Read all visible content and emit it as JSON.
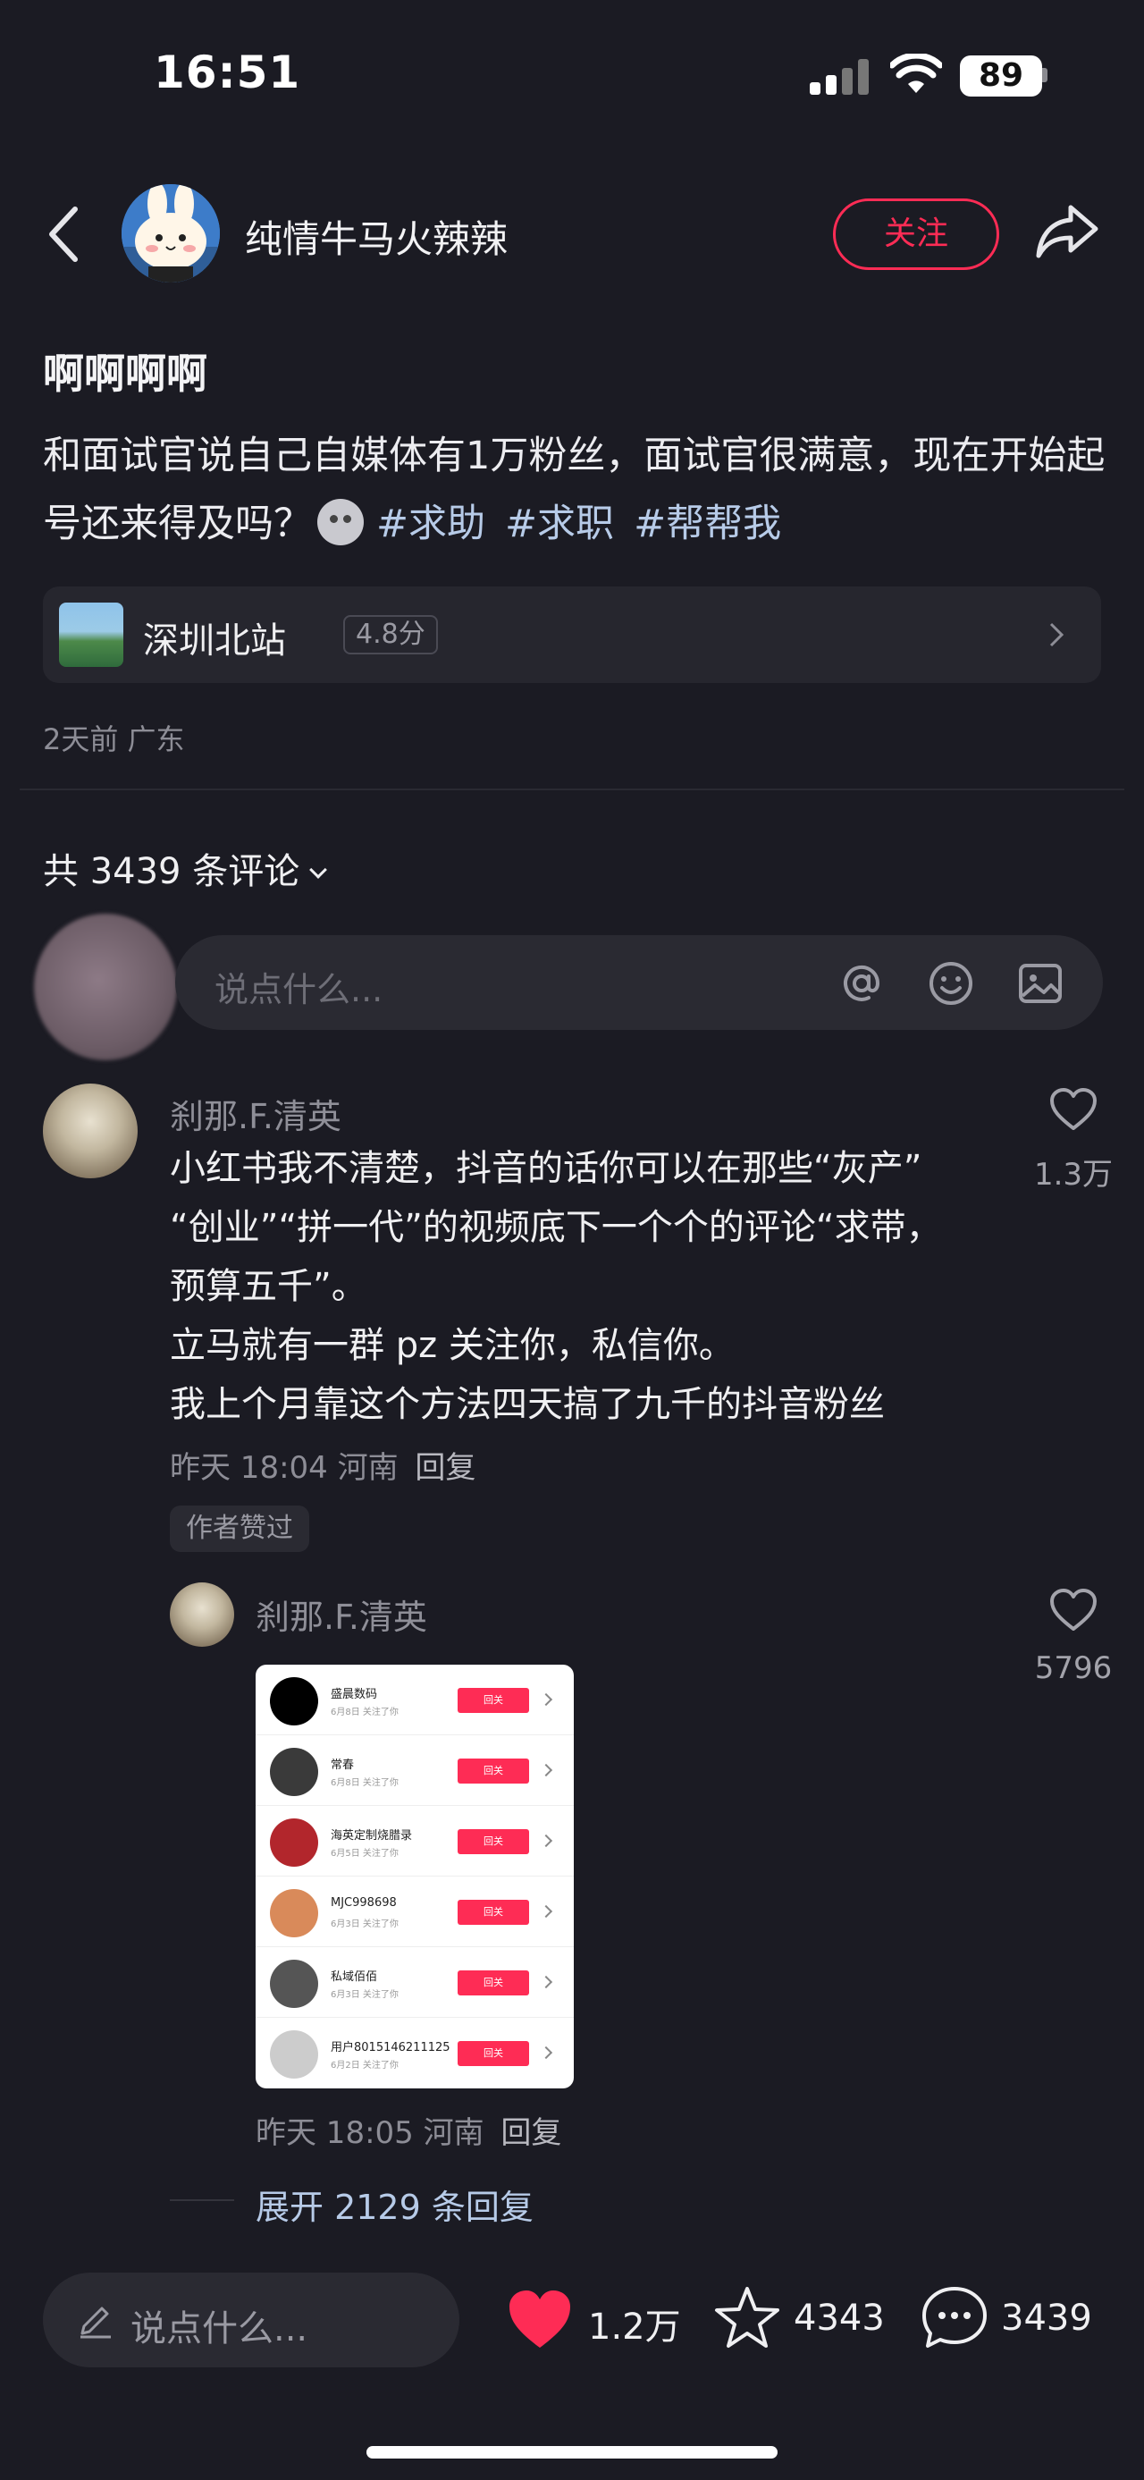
{
  "status_bar": {
    "time": "16:51",
    "battery": "89"
  },
  "header": {
    "author_name": "纯情牛马火辣辣",
    "follow_label": "关注",
    "icons": [
      "back-icon",
      "share-icon"
    ]
  },
  "post": {
    "title": "啊啊啊啊",
    "body": "和面试官说自己自媒体有1万粉丝，面试官很满意，现在开始起号还来得及吗？",
    "tags": [
      "#求助",
      "#求职",
      "#帮帮我"
    ],
    "location": {
      "name": "深圳北站",
      "rating": "4.8分"
    },
    "meta": "2天前 广东"
  },
  "comments_section": {
    "count_label": "共 3439 条评论",
    "compose_placeholder": "说点什么...",
    "compose_icons": [
      "at-icon",
      "emoji-icon",
      "image-icon"
    ],
    "comments": [
      {
        "user": "刹那.F.清英",
        "lines": [
          "小红书我不清楚，抖音的话你可以在那些“灰产”",
          "“创业”“拼一代”的视频底下一个个的评论“求带，",
          "预算五千”。",
          "立马就有一群 pz 关注你，私信你。",
          "我上个月靠这个方法四天搞了九千的抖音粉丝"
        ],
        "time": "昨天 18:04 河南",
        "reply_label": "回复",
        "like_count": "1.3万",
        "badge": "作者赞过"
      },
      {
        "user": "刹那.F.清英",
        "time": "昨天 18:05 河南",
        "reply_label": "回复",
        "like_count": "5796",
        "screenshot_rows": [
          {
            "name": "盛晨数码",
            "date": "6月8日 关注了你",
            "button": "回关",
            "avatar_color": "#000000"
          },
          {
            "name": "常春",
            "date": "6月8日 关注了你",
            "button": "回关",
            "avatar_color": "#3a3a3a"
          },
          {
            "name": "海英定制烧腊录",
            "date": "6月5日 关注了你",
            "button": "回关",
            "avatar_color": "#b2262c"
          },
          {
            "name": "MJC998698",
            "date": "6月3日 关注了你",
            "button": "回关",
            "avatar_color": "#d98a5a"
          },
          {
            "name": "私域佰佰",
            "date": "6月3日 关注了你",
            "button": "回关",
            "avatar_color": "#555555"
          },
          {
            "name": "用户8015146211125",
            "date": "6月2日 关注了你",
            "button": "回关",
            "avatar_color": "#cccccc"
          }
        ]
      }
    ],
    "expand_label": "展开 2129 条回复"
  },
  "bottom_bar": {
    "input_placeholder": "说点什么...",
    "like_count": "1.2万",
    "star_count": "4343",
    "comment_count": "3439"
  },
  "colors": {
    "accent": "#fe2c55",
    "tag": "#b7cbe8",
    "background": "#1b1b23"
  }
}
